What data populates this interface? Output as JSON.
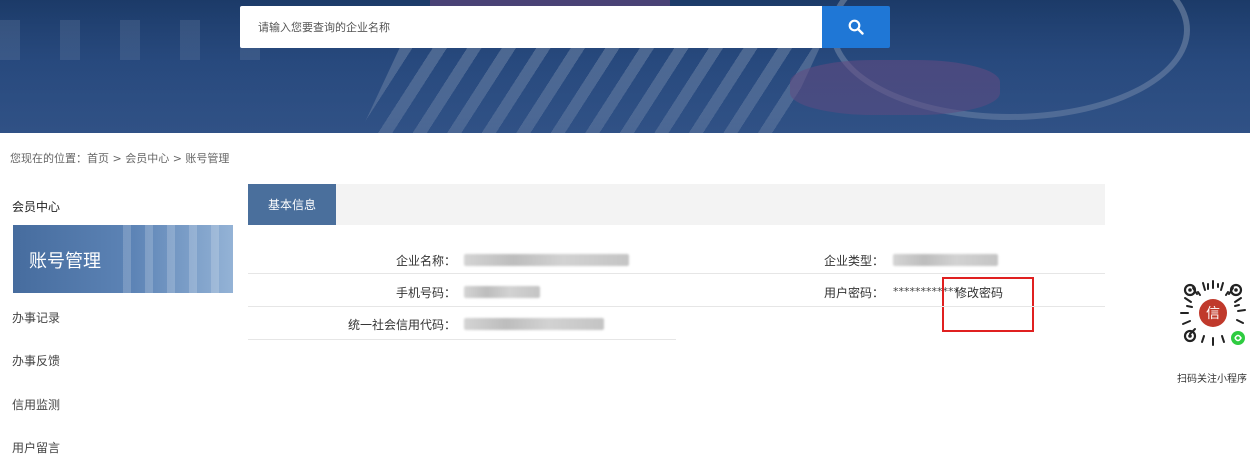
{
  "search": {
    "placeholder": "请输入您要查询的企业名称",
    "button_icon": "search-icon"
  },
  "breadcrumb": "您现在的位置：首页 > 会员中心 > 账号管理",
  "sidebar": {
    "title": "会员中心",
    "active": "账号管理",
    "items": [
      {
        "label": "办事记录"
      },
      {
        "label": "办事反馈"
      },
      {
        "label": "信用监测"
      },
      {
        "label": "用户留言"
      }
    ]
  },
  "main": {
    "tab": "基本信息",
    "fields": {
      "company_name_label": "企业名称：",
      "company_type_label": "企业类型：",
      "phone_label": "手机号码：",
      "password_label": "用户密码：",
      "password_value": "************",
      "change_password": "修改密码",
      "credit_code_label": "统一社会信用代码："
    }
  },
  "qr": {
    "caption": "扫码关注小程序",
    "center_char": "信"
  },
  "colors": {
    "search_button": "#1f77d6",
    "tab_active": "#4a6f9c",
    "highlight_box": "#e02020"
  }
}
